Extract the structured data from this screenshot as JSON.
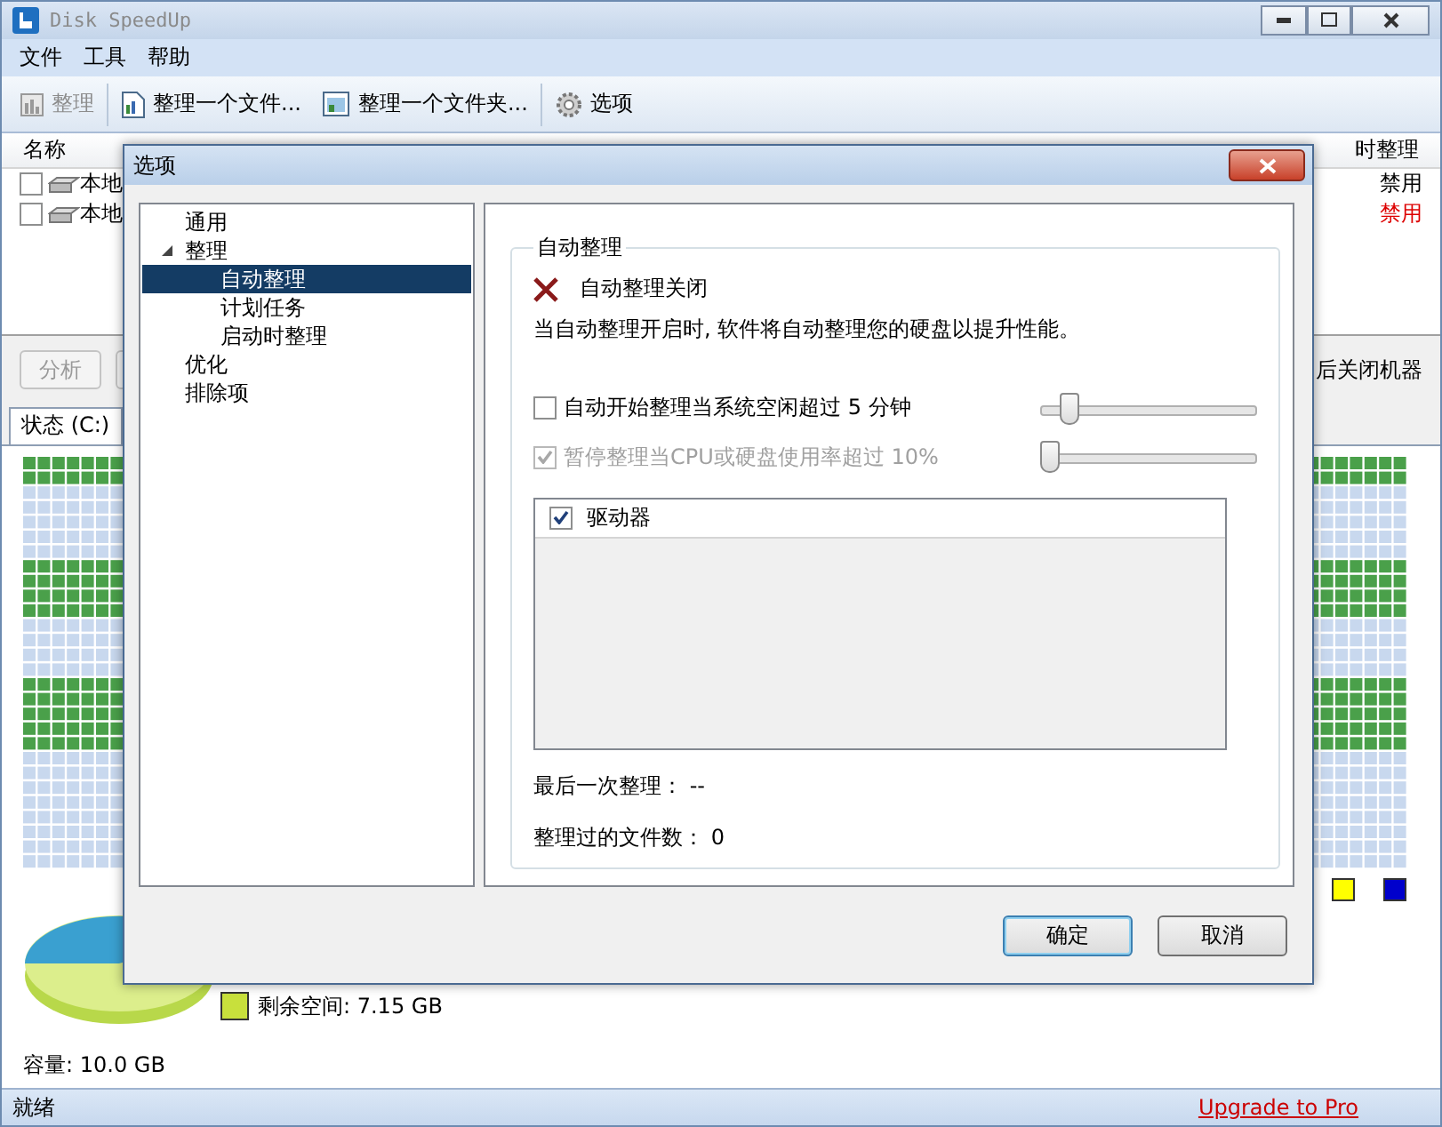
{
  "window": {
    "title": "Disk SpeedUp"
  },
  "menu": [
    "文件",
    "工具",
    "帮助"
  ],
  "toolbar": [
    {
      "label": "整理",
      "kind": "defrag",
      "disabled": true
    },
    {
      "label": "整理一个文件...",
      "kind": "file",
      "disabled": false
    },
    {
      "label": "整理一个文件夹...",
      "kind": "folder",
      "disabled": false
    },
    {
      "label": "选项",
      "kind": "options",
      "disabled": false
    }
  ],
  "drive_list": {
    "columns": [
      "名称",
      "时整理"
    ],
    "rows": [
      {
        "name": "本地",
        "status": "禁用",
        "checked": false,
        "color": "#000000"
      },
      {
        "name": "本地",
        "status": "禁用",
        "checked": false,
        "color": "#dd0000"
      }
    ]
  },
  "actions": {
    "buttons": [
      {
        "label": "分析",
        "disabled": true
      },
      {
        "disabled": true
      }
    ],
    "shutdown_option": "后关闭机器"
  },
  "tabs": [
    {
      "label": "状态 (C:)",
      "selected": true
    }
  ],
  "legend": {
    "colors": [
      {
        "color": "#ffff00"
      },
      {
        "color": "#0000cc"
      }
    ],
    "free_space": {
      "text": "剩余空间: 7.15 GB",
      "color": "#c8e03c"
    },
    "capacity": "容量: 10.0 GB"
  },
  "status_bar": {
    "text": "就绪",
    "link": "Upgrade to Pro"
  },
  "dialog": {
    "title": "选项",
    "tree": [
      {
        "label": "通用",
        "selected": false
      },
      {
        "label": "整理",
        "selected": false,
        "expanded": true,
        "children": [
          {
            "label": "自动整理",
            "selected": true
          },
          {
            "label": "计划任务",
            "selected": false
          },
          {
            "label": "启动时整理",
            "selected": false
          }
        ]
      },
      {
        "label": "优化",
        "selected": false
      },
      {
        "label": "排除项",
        "selected": false
      }
    ],
    "group_title": "自动整理",
    "state": {
      "text": "自动整理关闭",
      "on": false
    },
    "description": "当自动整理开启时, 软件将自动整理您的硬盘以提升性能。",
    "options": [
      {
        "label": "自动开始整理当系统空闲超过 5 分钟",
        "checked": false,
        "disabled": false,
        "level": 0.1
      },
      {
        "label": "暂停整理当CPU或硬盘使用率超过 10%",
        "checked": true,
        "disabled": true,
        "level": 0
      }
    ],
    "drives": {
      "header": "驱动器",
      "checked": true
    },
    "info": [
      "最后一次整理： --",
      "整理过的文件数： 0"
    ],
    "buttons": [
      {
        "label": "确定",
        "default": true
      },
      {
        "label": "取消",
        "default": false
      }
    ]
  }
}
